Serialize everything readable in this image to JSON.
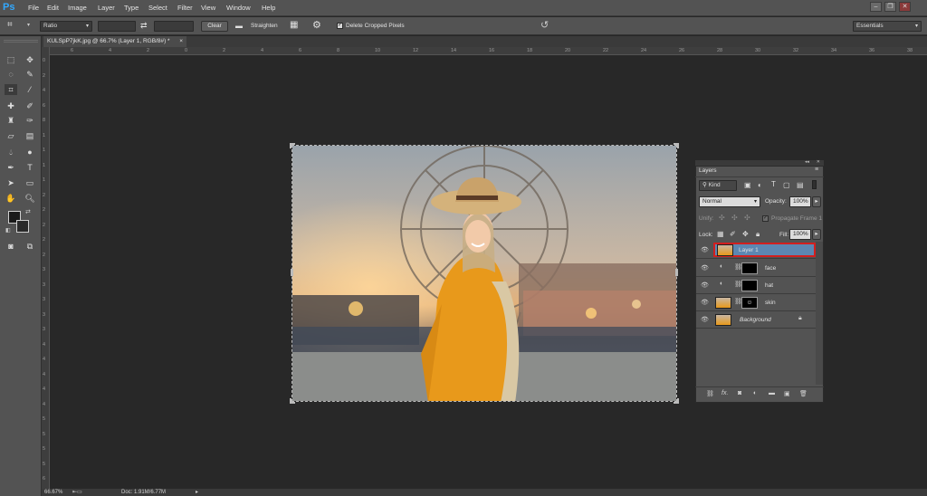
{
  "app": {
    "logo": "Ps",
    "menu": [
      "File",
      "Edit",
      "Image",
      "Layer",
      "Type",
      "Select",
      "Filter",
      "View",
      "Window",
      "Help"
    ],
    "window_controls": [
      "minimize-icon",
      "restore-icon",
      "close-icon"
    ]
  },
  "options": {
    "ratio_value": "Ratio",
    "width_value": "",
    "height_value": "",
    "clear_label": "Clear",
    "straighten_label": "Straighten",
    "delete_cropped_label": "Delete Cropped Pixels",
    "delete_cropped_checked": true,
    "workspace": "Essentials"
  },
  "document": {
    "tab_title": "KULSpP7jkK.jpg @ 66.7% (Layer 1, RGB/8#) *",
    "tab_close": "×"
  },
  "rulers": {
    "h_ticks": [
      "6",
      "4",
      "2",
      "0",
      "2",
      "4",
      "6",
      "8",
      "10",
      "12",
      "14",
      "16",
      "18",
      "20",
      "22",
      "24",
      "26",
      "28",
      "30",
      "32",
      "34",
      "36",
      "38"
    ],
    "v_ticks": [
      "0",
      "2",
      "4",
      "6",
      "8",
      "1",
      "1",
      "1",
      "1",
      "2",
      "2",
      "2",
      "2",
      "2",
      "3",
      "3",
      "3",
      "3",
      "3",
      "4",
      "4",
      "4",
      "4",
      "4",
      "5",
      "5",
      "5",
      "5",
      "6"
    ]
  },
  "layers_panel": {
    "title": "Layers",
    "kind_label": "Kind",
    "blend_mode": "Normal",
    "opacity_label": "Opacity:",
    "opacity_value": "100%",
    "unify_label": "Unify:",
    "propagate_label": "Propagate Frame 1",
    "lock_label": "Lock:",
    "fill_label": "Fill:",
    "fill_value": "100%",
    "layers": [
      {
        "name": "Layer 1",
        "selected": true
      },
      {
        "name": "face"
      },
      {
        "name": "hat"
      },
      {
        "name": "skin"
      },
      {
        "name": "Background",
        "locked": true
      }
    ]
  },
  "status": {
    "zoom": "66.67%",
    "doc_info": "Doc: 1.91M/6.77M"
  },
  "colors": {
    "accent": "#31a8ff",
    "selection_outline": "#d21f1f",
    "selected_row": "#5c87b2"
  }
}
